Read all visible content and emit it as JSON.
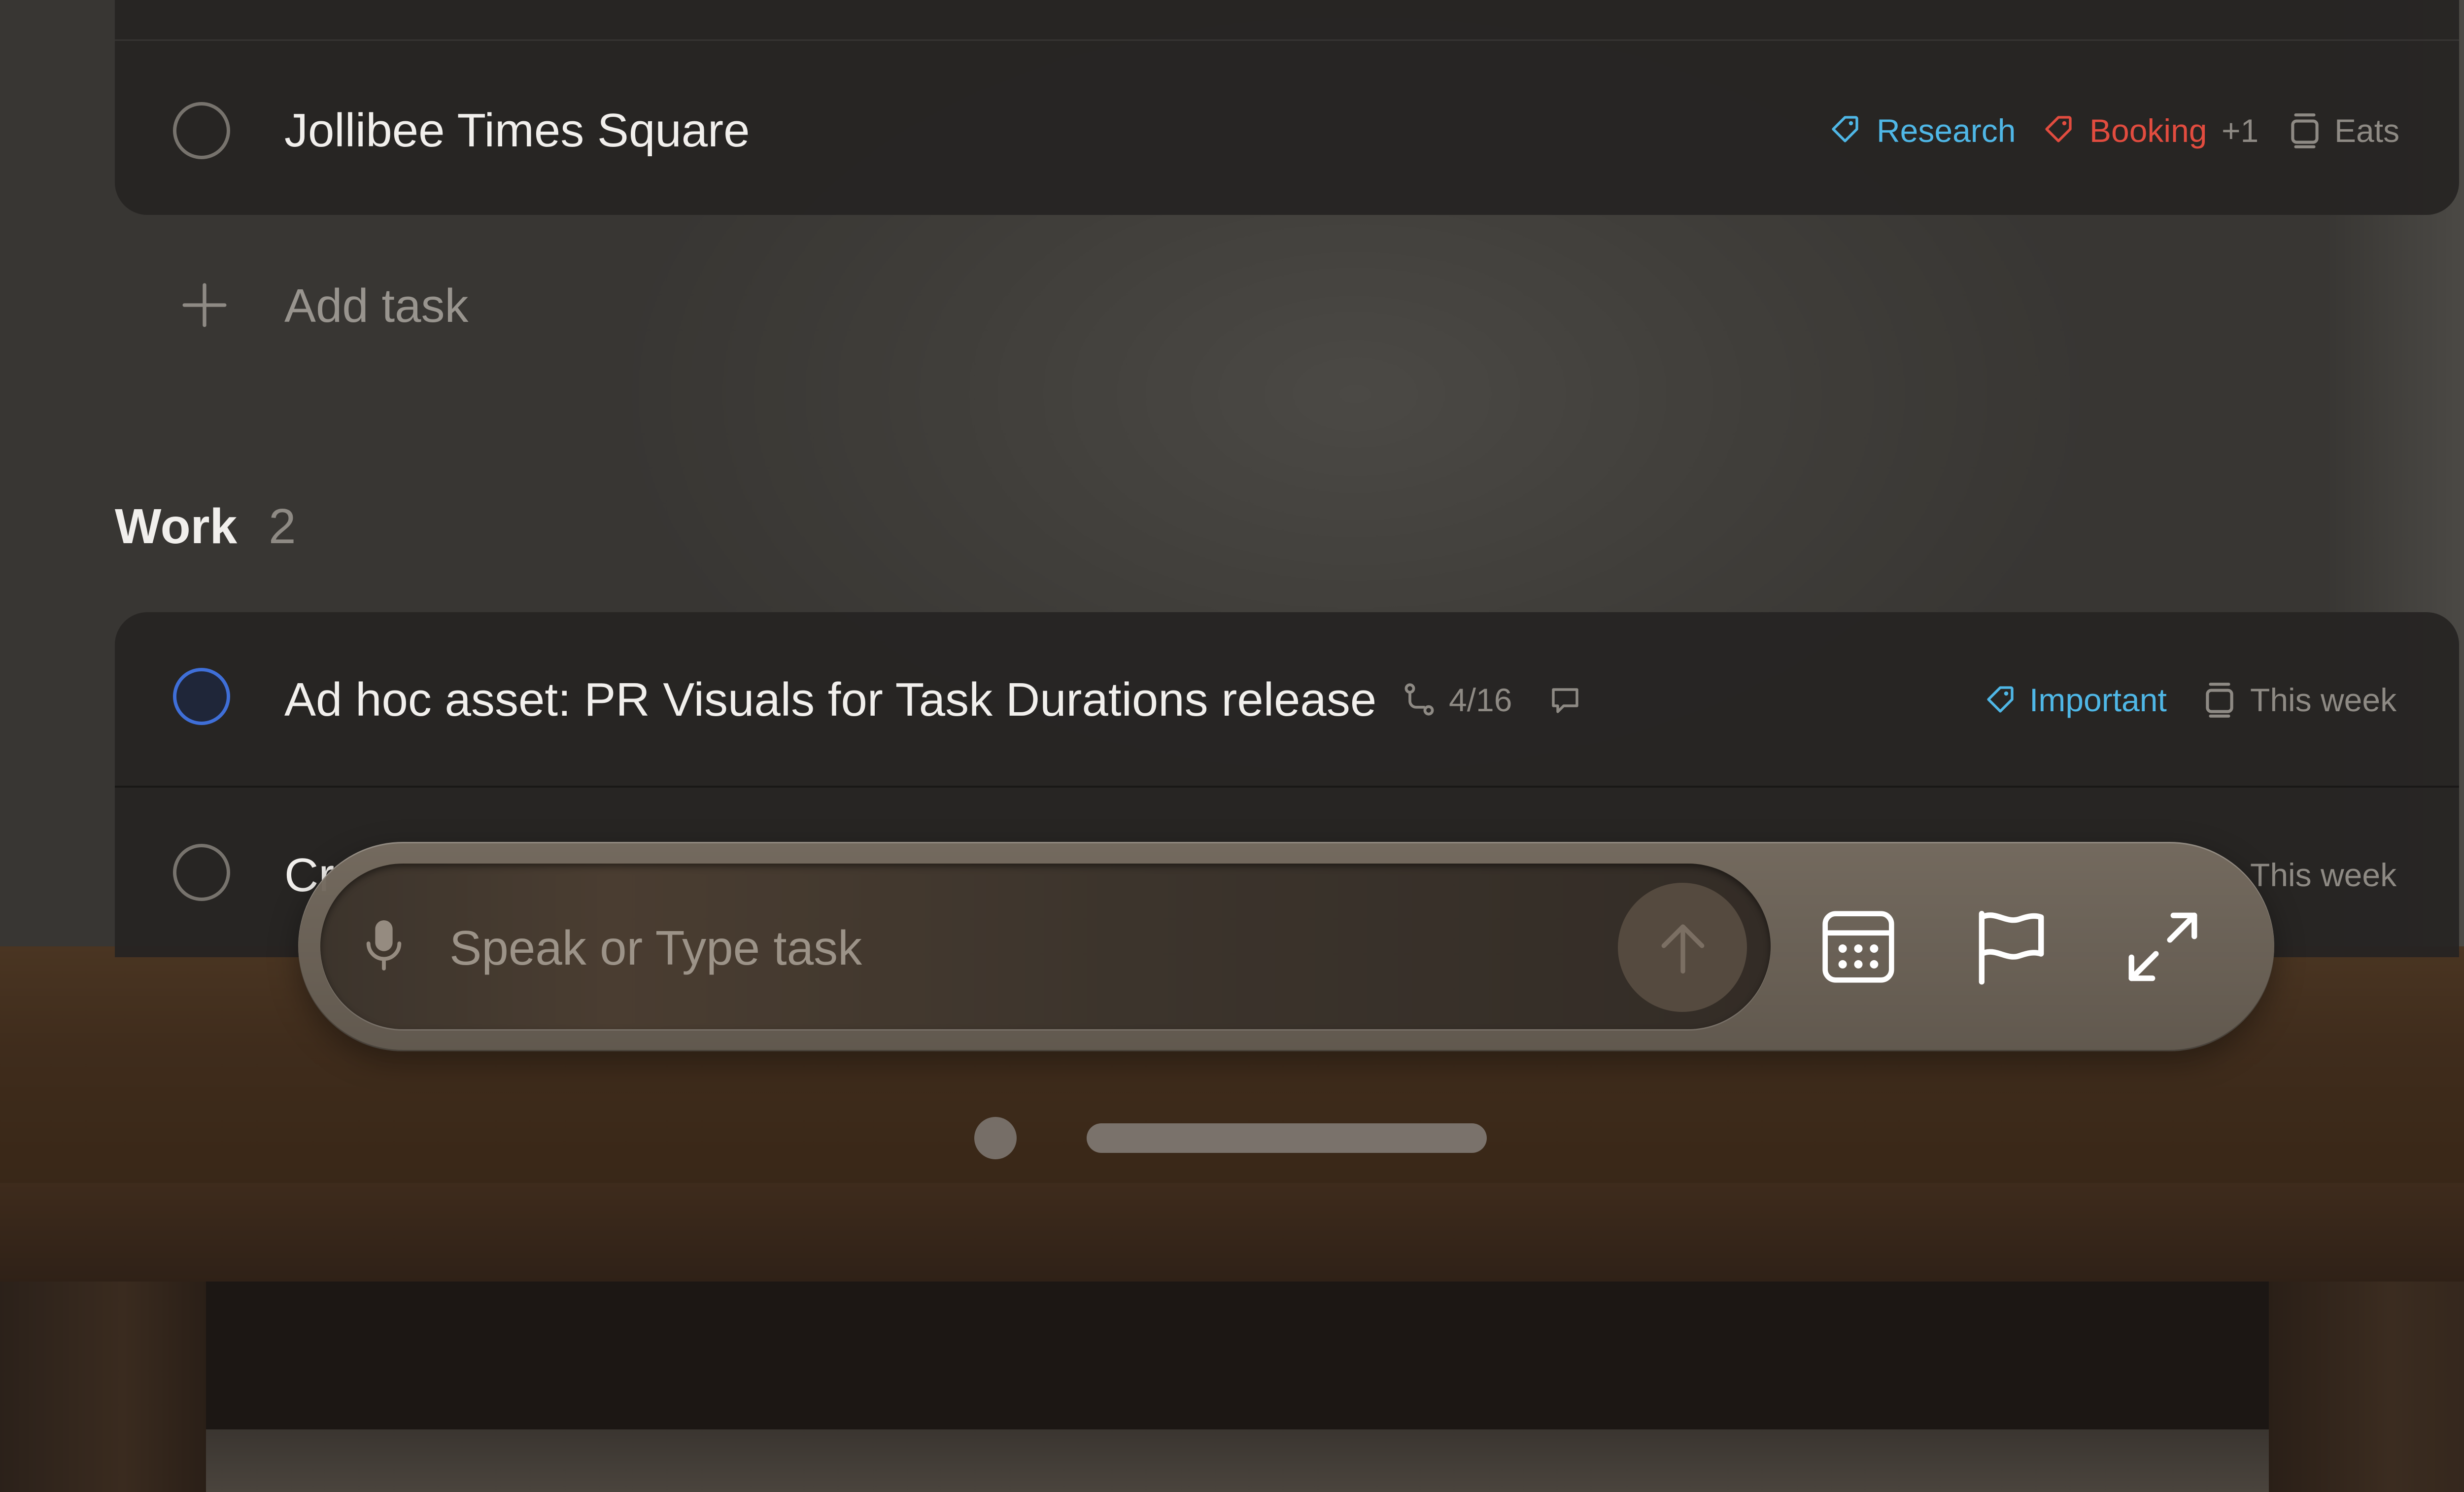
{
  "list": {
    "top_task": {
      "title": "Jollibee Times Square",
      "labels": [
        {
          "text": "Research",
          "color": "#4fb7e6",
          "icon": "tag-icon"
        },
        {
          "text": "Booking",
          "color": "#e24c3f",
          "icon": "tag-icon"
        }
      ],
      "extra_labels": "+1",
      "project": "Eats",
      "project_icon": "list-icon"
    },
    "add_task_label": "Add task",
    "section": {
      "name": "Work",
      "count": "2",
      "tasks": [
        {
          "title": "Ad hoc asset: PR Visuals for Task Durations release",
          "subtasks": "4/16",
          "subtask_icon": "subtask-icon",
          "has_comment": true,
          "comment_icon": "comment-icon",
          "label": "Important",
          "label_color": "#4fb7e6",
          "due": "This week",
          "priority_ring_color": "#3f6fd8"
        },
        {
          "title": "Cr",
          "due": "This week"
        }
      ]
    }
  },
  "input_bar": {
    "placeholder": "Speak or Type task",
    "mic_icon": "microphone-icon",
    "send_icon": "arrow-up-icon",
    "buttons": [
      {
        "name": "date",
        "icon": "calendar-icon"
      },
      {
        "name": "priority",
        "icon": "flag-icon"
      },
      {
        "name": "expand",
        "icon": "expand-icon"
      }
    ]
  },
  "colors": {
    "accent_blue": "#4fb7e6",
    "accent_red": "#e24c3f",
    "priority_blue": "#3f6fd8"
  }
}
